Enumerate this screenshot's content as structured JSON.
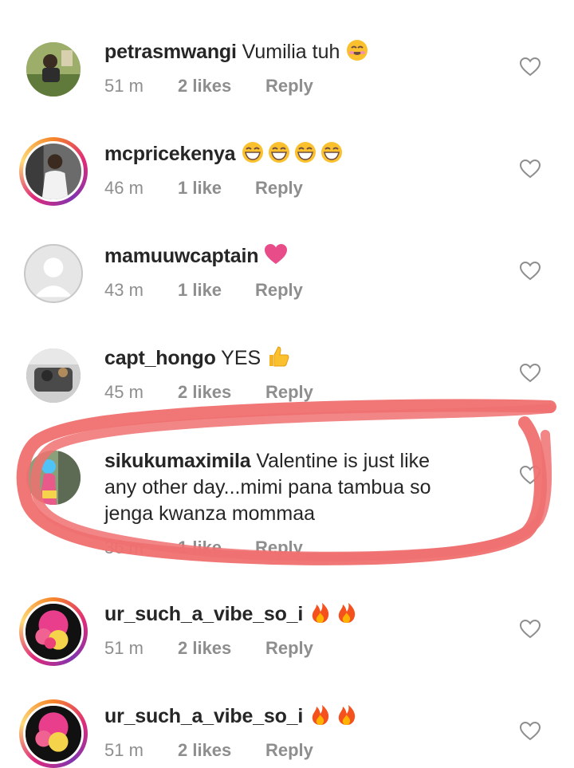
{
  "comments": [
    {
      "username": "petrasmwangi",
      "text": "Vumilia tuh",
      "emoji": [
        "smiling-face-icon"
      ],
      "time": "51 m",
      "likes": "2 likes",
      "reply": "Reply"
    },
    {
      "username": "mcpricekenya",
      "text": "",
      "emoji": [
        "grinning-face-icon",
        "grinning-face-icon",
        "grinning-face-icon",
        "grinning-face-icon"
      ],
      "time": "46 m",
      "likes": "1 like",
      "reply": "Reply"
    },
    {
      "username": "mamuuwcaptain",
      "text": "",
      "emoji": [
        "pink-heart-icon"
      ],
      "time": "43 m",
      "likes": "1 like",
      "reply": "Reply"
    },
    {
      "username": "capt_hongo",
      "text": "YES",
      "emoji": [
        "thumbs-up-icon"
      ],
      "time": "45 m",
      "likes": "2 likes",
      "reply": "Reply"
    },
    {
      "username": "sikukumaximila",
      "text_lines": [
        "Valentine is just like",
        "any other day...mimi pana tambua so",
        "jenga kwanza mommaa"
      ],
      "time": "36 m",
      "likes": "1 like",
      "reply": "Reply"
    },
    {
      "username": "ur_such_a_vibe_so_i",
      "text": "",
      "emoji": [
        "fire-icon",
        "fire-icon"
      ],
      "time": "51 m",
      "likes": "2 likes",
      "reply": "Reply"
    },
    {
      "username": "ur_such_a_vibe_so_i",
      "text": "",
      "emoji": [
        "fire-icon",
        "fire-icon"
      ],
      "time": "51 m",
      "likes": "2 likes",
      "reply": "Reply"
    }
  ],
  "colors": {
    "highlight_scribble": "#f07070",
    "like_heart_outline": "#8e8e8e",
    "meta_text": "#8e8e8e"
  }
}
